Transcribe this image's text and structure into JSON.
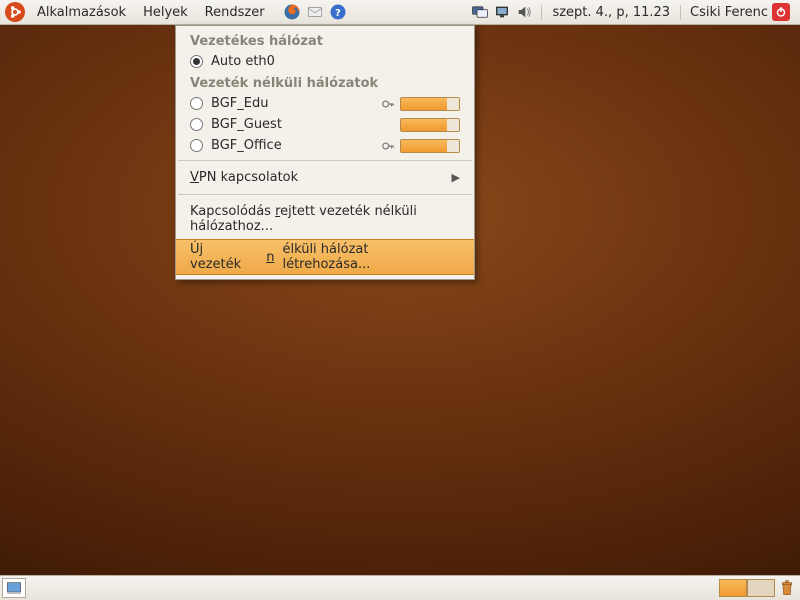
{
  "top_panel": {
    "menus": [
      "Alkalmazások",
      "Helyek",
      "Rendszer"
    ],
    "clock": "szept.  4., p, 11.23",
    "user": "Csiki Ferenc"
  },
  "nm": {
    "wired_header": "Vezetékes hálózat",
    "wired_item": "Auto eth0",
    "wifi_header": "Vezeték nélküli hálózatok",
    "networks": [
      {
        "ssid": "BGF_Edu",
        "enc": true,
        "strength": 0.8
      },
      {
        "ssid": "BGF_Guest",
        "enc": false,
        "strength": 0.8
      },
      {
        "ssid": "BGF_Office",
        "enc": true,
        "strength": 0.8
      }
    ],
    "vpn": "VPN kapcsolatok",
    "connect_hidden": "Kapcsolódás rejtett vezeték nélküli hálózathoz...",
    "create_new": "Új vezeték nélküli hálózat létrehozása..."
  }
}
